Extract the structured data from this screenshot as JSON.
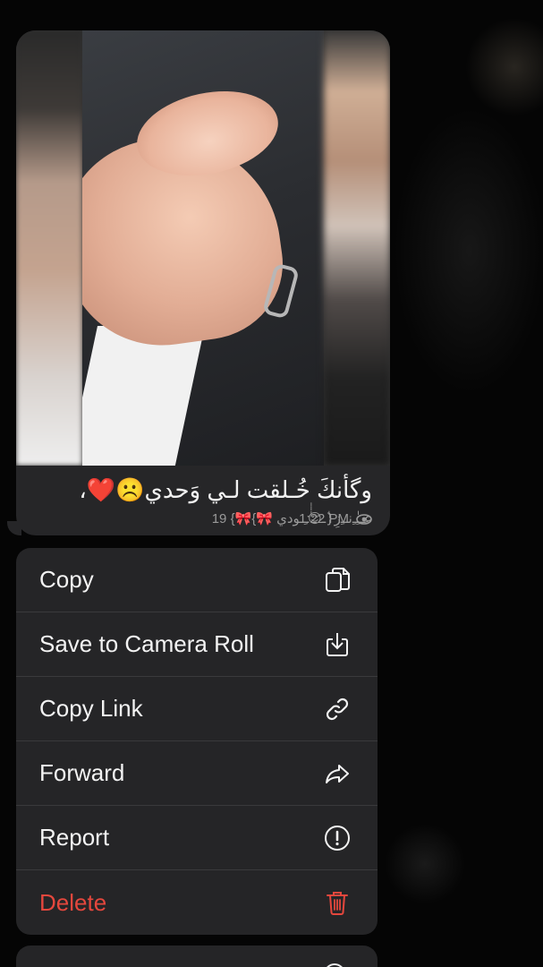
{
  "message": {
    "caption": "وگأنكَ خُـلقت لـي وَحدي☹️❤️،",
    "sender": "19 {🎀عـﹻٰٰٰﹻنـﹻزِ{ٰـ😌ٰٰٰﹻـودي 🎀}",
    "time": "1:22 PM",
    "view_icon": "eye-icon",
    "photo_description_icon": "photo"
  },
  "menu": {
    "items": [
      {
        "label": "Copy",
        "icon": "copy-icon",
        "danger": false
      },
      {
        "label": "Save to Camera Roll",
        "icon": "save-icon",
        "danger": false
      },
      {
        "label": "Copy Link",
        "icon": "link-icon",
        "danger": false
      },
      {
        "label": "Forward",
        "icon": "forward-icon",
        "danger": false
      },
      {
        "label": "Report",
        "icon": "report-icon",
        "danger": false
      },
      {
        "label": "Delete",
        "icon": "trash-icon",
        "danger": true
      }
    ]
  },
  "colors": {
    "background": "#050505",
    "bubble": "#262628",
    "menu": "#252527",
    "danger": "#e4473d",
    "text": "#f3f3f3",
    "meta": "#9a9a9a"
  }
}
